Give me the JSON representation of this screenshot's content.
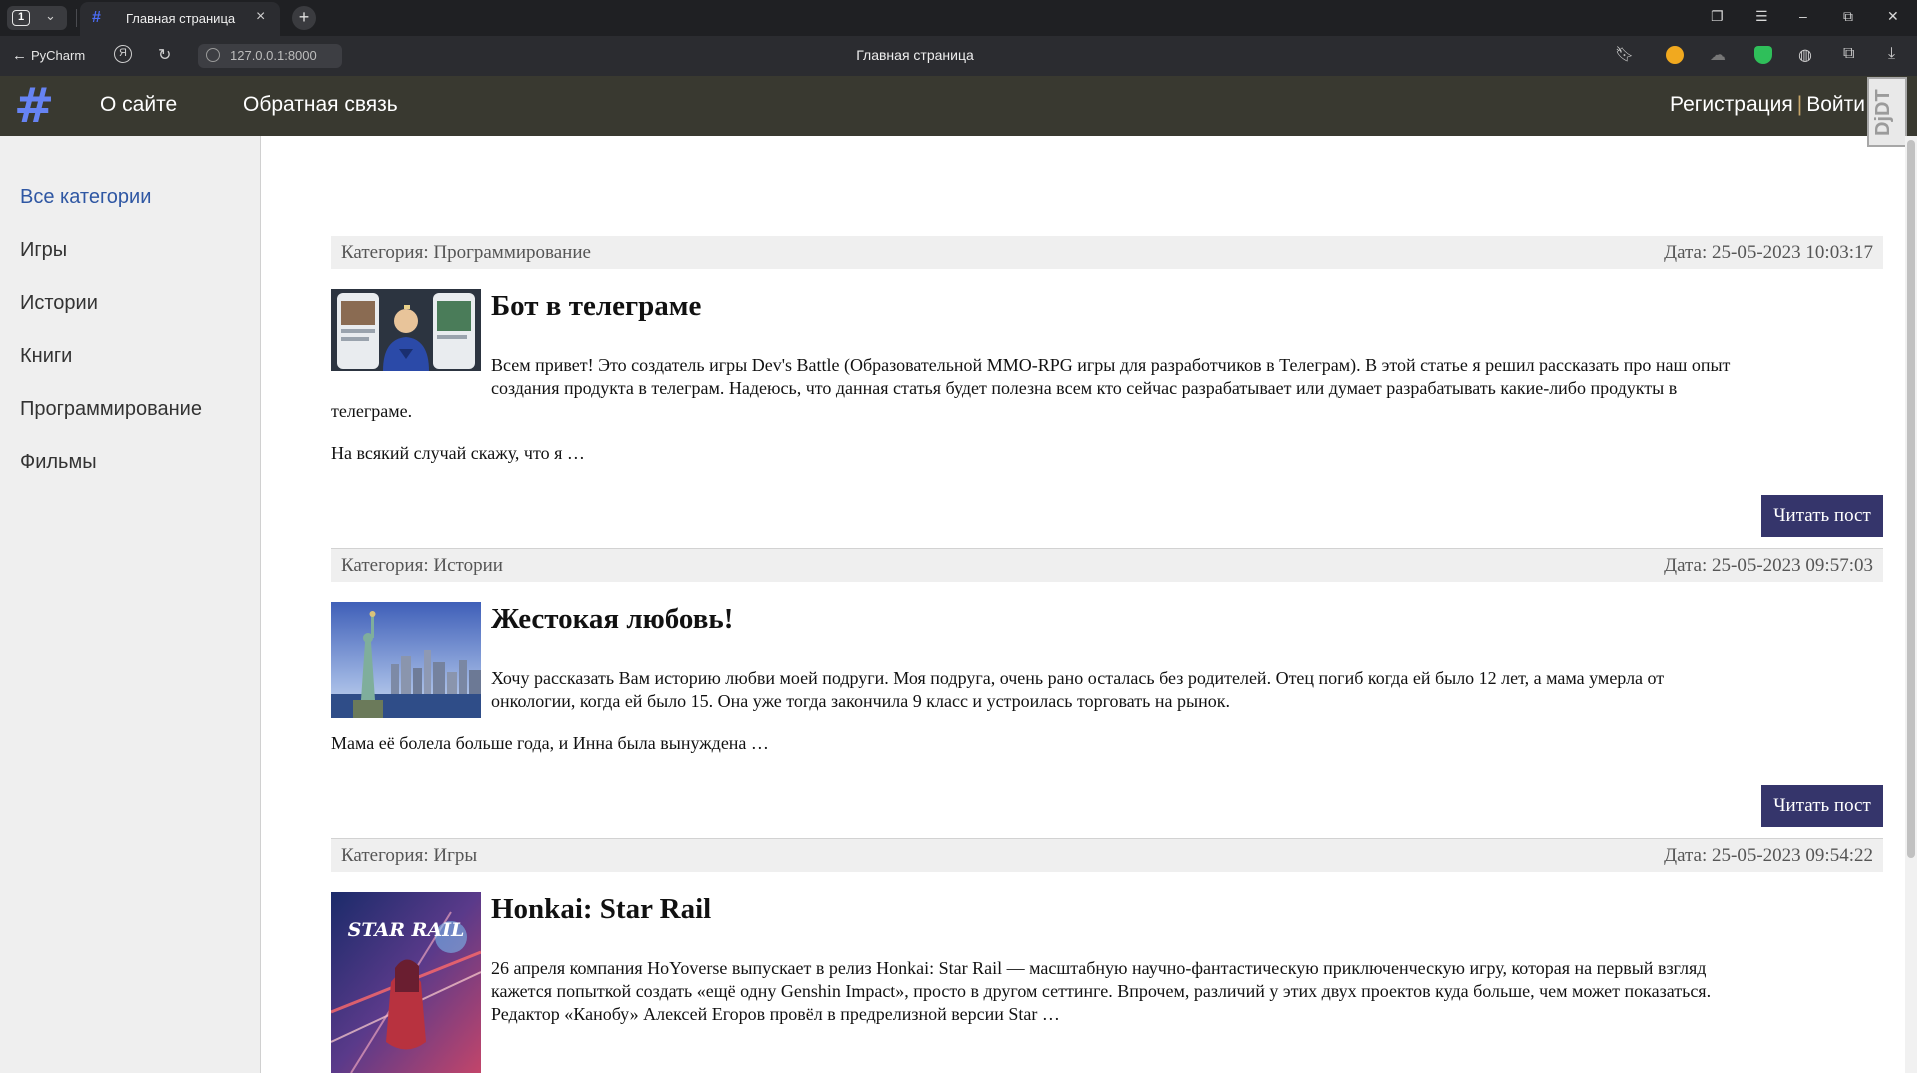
{
  "browser": {
    "tab_count": "1",
    "tab_title": "Главная страница",
    "back_label": "PyCharm",
    "url": "127.0.0.1:8000",
    "page_title": "Главная страница"
  },
  "site": {
    "logo_glyph": "#",
    "nav": [
      {
        "label": "О сайте"
      },
      {
        "label": "Обратная связь"
      }
    ],
    "auth": {
      "register": "Регистрация",
      "separator": "|",
      "login": "Войти"
    },
    "debug_toolbar_label": "DjDT"
  },
  "sidebar": {
    "categories": [
      {
        "label": "Все категории",
        "active": true
      },
      {
        "label": "Игры"
      },
      {
        "label": "Истории"
      },
      {
        "label": "Книги"
      },
      {
        "label": "Программирование"
      },
      {
        "label": "Фильмы"
      }
    ]
  },
  "posts": [
    {
      "category": "Категория: Программирование",
      "date": "Дата: 25-05-2023 10:03:17",
      "title": "Бот в телеграме",
      "body_line1": "Всем привет! Это создатель игры Dev's Battle (Образовательной MMO-RPG игры для разработчиков в Телеграм). В этой статье я решил рассказать про наш опыт",
      "body_line2": "создания продукта в телеграм. Надеюсь, что данная статья будет полезна всем кто сейчас разрабатывает или думает разрабатывать какие-либо продукты в",
      "body_line3": "телеграме.",
      "more": "На всякий случай скажу, что я …",
      "button": "Читать пост"
    },
    {
      "category": "Категория: Истории",
      "date": "Дата: 25-05-2023 09:57:03",
      "title": "Жестокая любовь!",
      "body_line1": "Хочу рассказать Вам историю любви моей подруги. Моя подруга, очень рано осталась без родителей. Отец погиб когда ей было 12 лет, а мама умерла от",
      "body_line2": "онкологии, когда ей было 15. Она уже тогда закончила 9 класс и устроилась торговать на рынок.",
      "more": "Мама её болела больше года, и Инна была вынуждена …",
      "button": "Читать пост"
    },
    {
      "category": "Категория: Игры",
      "date": "Дата: 25-05-2023 09:54:22",
      "title": "Honkai: Star Rail",
      "body_line1": "26 апреля компания HoYoverse выпускает в релиз Honkai: Star Rail — масштабную научно-фантастическую приключенческую игру, которая на первый взгляд",
      "body_line2": "кажется попыткой создать «ещё одну Genshin Impact», просто в другом сеттинге. Впрочем, различий у этих двух проектов куда больше, чем может показаться.",
      "body_line3": "Редактор «Канобу» Алексей Егоров провёл в предрелизной версии Star …",
      "thumb_text": "STAR RAIL"
    }
  ]
}
